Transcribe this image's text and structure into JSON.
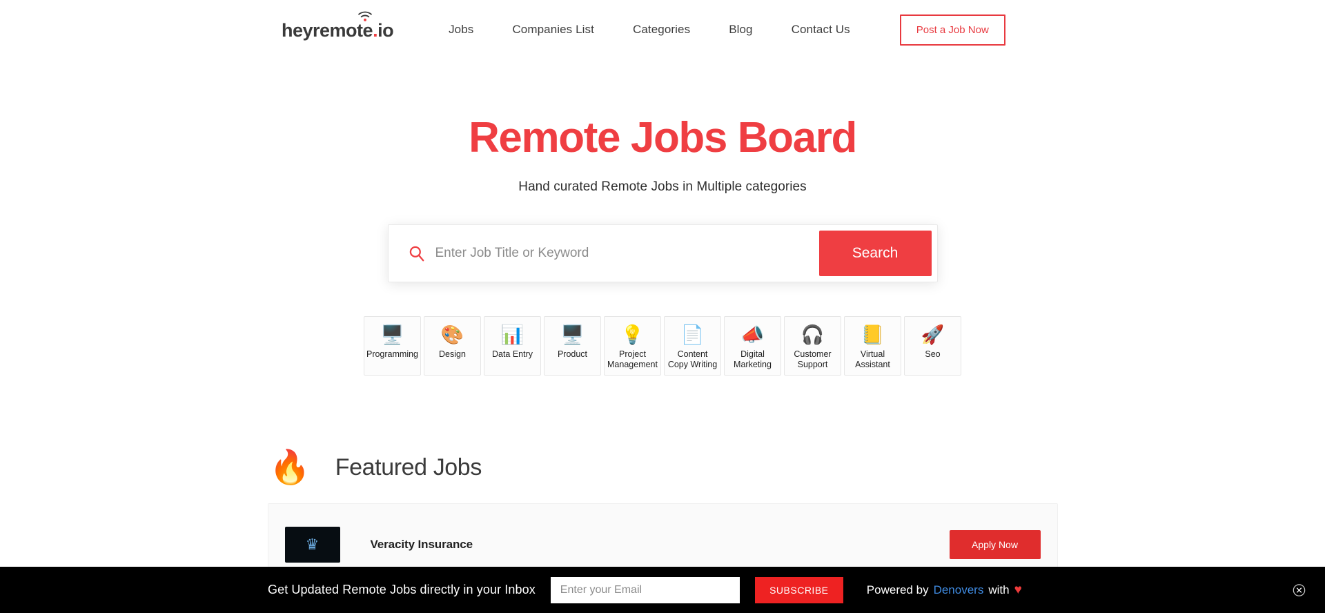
{
  "header": {
    "logo": {
      "main": "heyremote",
      "dot": ".",
      "tld": "io",
      "icon": "wifi-icon"
    },
    "nav": [
      {
        "label": "Jobs"
      },
      {
        "label": "Companies List"
      },
      {
        "label": "Categories"
      },
      {
        "label": "Blog"
      },
      {
        "label": "Contact Us"
      }
    ],
    "post_job_label": "Post a Job Now"
  },
  "hero": {
    "title": "Remote Jobs Board",
    "subtitle": "Hand curated Remote Jobs in Multiple categories"
  },
  "search": {
    "icon": "search-icon",
    "placeholder": "Enter Job Title or Keyword",
    "value": "",
    "button_label": "Search"
  },
  "categories": [
    {
      "label": "Programming",
      "icon": "🖥️"
    },
    {
      "label": "Design",
      "icon": "🎨"
    },
    {
      "label": "Data Entry",
      "icon": "📊"
    },
    {
      "label": "Product",
      "icon": "🖥️"
    },
    {
      "label": "Project Management",
      "icon": "💡"
    },
    {
      "label": "Content Copy Writing",
      "icon": "📄"
    },
    {
      "label": "Digital Marketing",
      "icon": "📣"
    },
    {
      "label": "Customer Support",
      "icon": "🎧"
    },
    {
      "label": "Virtual Assistant",
      "icon": "📒"
    },
    {
      "label": "Seo",
      "icon": "🚀"
    }
  ],
  "featured": {
    "icon": "🔥",
    "title": "Featured Jobs",
    "jobs": [
      {
        "company": "Veracity Insurance",
        "logo_glyph": "♛",
        "apply_label": "Apply Now"
      }
    ]
  },
  "subscribe": {
    "text": "Get Updated Remote Jobs directly in your Inbox",
    "email_placeholder": "Enter your Email",
    "email_value": "",
    "button_label": "SUBSCRIBE",
    "powered_prefix": "Powered by",
    "powered_brand": "Denovers",
    "powered_suffix": "with",
    "heart": "♥",
    "close_icon": "close-icon"
  },
  "colors": {
    "accent_red": "#ef3e42",
    "button_red": "#e02d2d",
    "link_blue": "#3f8ae0",
    "bar_black": "#000000"
  }
}
